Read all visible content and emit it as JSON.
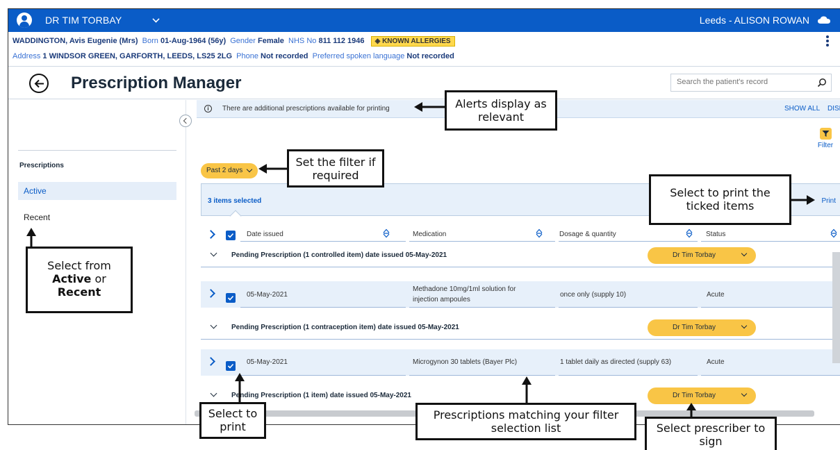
{
  "topbar": {
    "user_name": "DR TIM TORBAY",
    "location": "Leeds - ALISON ROWAN"
  },
  "patient": {
    "name": "WADDINGTON, Avis Eugenie (Mrs)",
    "born_label": "Born",
    "born": "01-Aug-1964 (56y)",
    "gender_label": "Gender",
    "gender": "Female",
    "nhs_label": "NHS No",
    "nhs": "811 112 1946",
    "allergy_badge": "KNOWN ALLERGIES",
    "address_label": "Address",
    "address": "1 WINDSOR GREEN, GARFORTH, LEEDS, LS25 2LG",
    "phone_label": "Phone",
    "phone": "Not recorded",
    "language_label": "Preferred spoken language",
    "language": "Not recorded"
  },
  "header": {
    "title": "Prescription Manager",
    "search_placeholder": "Search the patient's record"
  },
  "sidebar": {
    "heading": "Prescriptions",
    "items": [
      {
        "label": "Active"
      },
      {
        "label": "Recent"
      }
    ]
  },
  "alert": {
    "text": "There are additional prescriptions available for printing",
    "show_all": "SHOW ALL",
    "dismiss": "DISMISS"
  },
  "filter": {
    "label": "Filter",
    "date_filter": "Past 2 days"
  },
  "selection": {
    "count_text": "3 items selected",
    "print_label": "Print"
  },
  "table": {
    "columns": [
      "Date issued",
      "Medication",
      "Dosage & quantity",
      "Status"
    ],
    "groups": [
      {
        "title": "Pending Prescription (1 controlled item) date issued 05-May-2021",
        "prescriber": "Dr Tim Torbay",
        "item": {
          "date": "05-May-2021",
          "medication_line1": "Methadone 10mg/1ml solution for",
          "medication_line2": "injection ampoules",
          "dosage": "once only (supply 10)",
          "status": "Acute"
        }
      },
      {
        "title": "Pending Prescription (1 contraception item) date issued 05-May-2021",
        "prescriber": "Dr Tim Torbay",
        "item": {
          "date": "05-May-2021",
          "medication_line1": "Microgynon 30 tablets (Bayer Plc)",
          "medication_line2": "",
          "dosage": "1 tablet daily as directed (supply 63)",
          "status": "Acute"
        }
      },
      {
        "title": "Pending Prescription (1 item) date issued 05-May-2021",
        "prescriber": "Dr Tim Torbay"
      }
    ]
  },
  "callouts": {
    "alerts": [
      "Alerts display as",
      "relevant"
    ],
    "filter": [
      "Set the filter if",
      "required"
    ],
    "print": [
      "Select to print the",
      "ticked items"
    ],
    "nav_pre": "Select from",
    "nav_active": "Active",
    "nav_or": "or",
    "nav_recent": "Recent",
    "select_print": [
      "Select to",
      "print"
    ],
    "matching": [
      "Prescriptions matching your filter",
      "selection list"
    ],
    "prescriber": [
      "Select prescriber to",
      "sign"
    ]
  },
  "colors": {
    "brand_blue": "#0a5cc7",
    "highlight_yellow": "#f9c546",
    "row_bg": "#e7f0fa"
  }
}
